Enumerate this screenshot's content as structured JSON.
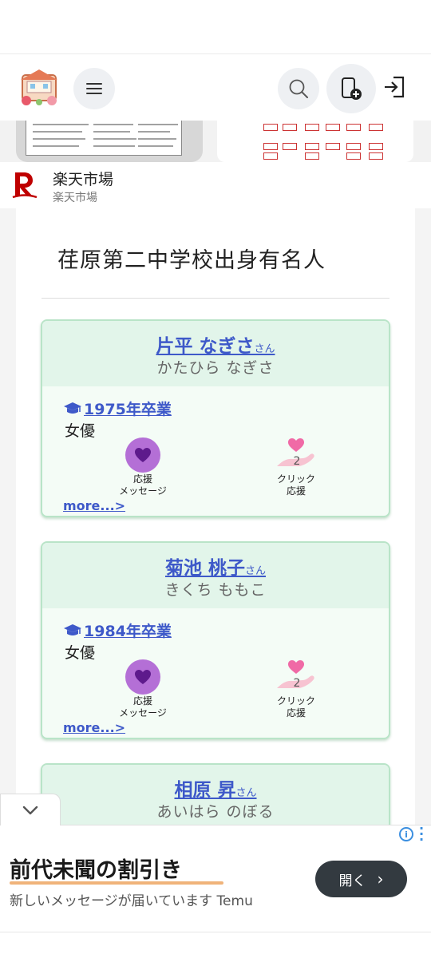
{
  "header": {
    "menu_icon": "hamburger-icon",
    "search_icon": "search-icon",
    "add_page_icon": "add-page-icon",
    "login_icon": "login-icon"
  },
  "top_ad": {
    "title": "楽天市場",
    "subtitle": "楽天市場",
    "brand_color": "#bf0000"
  },
  "page": {
    "title": "荏原第二中学校出身有名人"
  },
  "people": [
    {
      "name": "片平 なぎさ",
      "honorific": "さん",
      "kana": "かたひら なぎさ",
      "graduation": "1975年卒業",
      "job": "女優",
      "cheer_message_label_1": "応援",
      "cheer_message_label_2": "メッセージ",
      "click_count": "2",
      "click_label_1": "クリック",
      "click_label_2": "応援",
      "more": "more...>"
    },
    {
      "name": "菊池 桃子",
      "honorific": "さん",
      "kana": "きくち ももこ",
      "graduation": "1984年卒業",
      "job": "女優",
      "cheer_message_label_1": "応援",
      "cheer_message_label_2": "メッセージ",
      "click_count": "2",
      "click_label_1": "クリック",
      "click_label_2": "応援",
      "more": "more...>"
    },
    {
      "name": "相原 昇",
      "honorific": "さん",
      "kana": "あいはら のぼる"
    }
  ],
  "bottom_ad": {
    "headline": "前代未聞の割引き",
    "subtext": "新しいメッセージが届いています Temu",
    "open_button": "開く",
    "accent_color": "#f0b37a"
  },
  "colors": {
    "link": "#3e59c9",
    "card_bg": "#f4fcf6",
    "card_head": "#e2f5ea",
    "card_border": "#b9e4c8",
    "bubble": "#b46fd6",
    "heart": "#f06aa6"
  }
}
